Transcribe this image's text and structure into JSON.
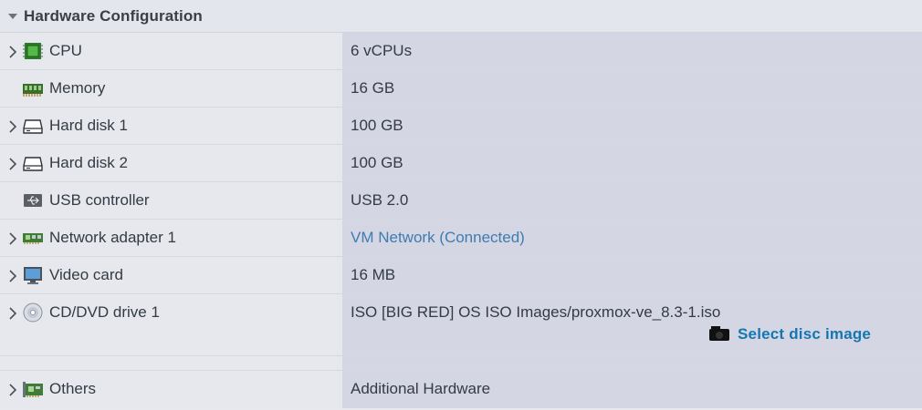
{
  "section": {
    "title": "Hardware Configuration"
  },
  "rows": [
    {
      "label": "CPU",
      "value": "6 vCPUs",
      "icon": "cpu-icon",
      "expandable": true
    },
    {
      "label": "Memory",
      "value": "16 GB",
      "icon": "memory-icon",
      "expandable": false
    },
    {
      "label": "Hard disk 1",
      "value": "100 GB",
      "icon": "hard-disk-icon",
      "expandable": true
    },
    {
      "label": "Hard disk 2",
      "value": "100 GB",
      "icon": "hard-disk-icon",
      "expandable": true
    },
    {
      "label": "USB controller",
      "value": "USB 2.0",
      "icon": "usb-icon",
      "expandable": false
    },
    {
      "label": "Network adapter 1",
      "value": "VM Network (Connected)",
      "icon": "network-adapter-icon",
      "expandable": true
    },
    {
      "label": "Video card",
      "value": "16 MB",
      "icon": "monitor-icon",
      "expandable": true
    },
    {
      "label": "CD/DVD drive 1",
      "value": "ISO [BIG RED] OS ISO Images/proxmox-ve_8.3-1.iso",
      "icon": "cd-dvd-icon",
      "expandable": true,
      "action": "Select disc image"
    },
    {
      "label": "Others",
      "value": "Additional Hardware",
      "icon": "others-card-icon",
      "expandable": true
    }
  ],
  "colors": {
    "link": "#3f7cb1",
    "action": "#1676b3",
    "value_column": "#d4d6e3",
    "label_column": "#e6e8ed"
  }
}
